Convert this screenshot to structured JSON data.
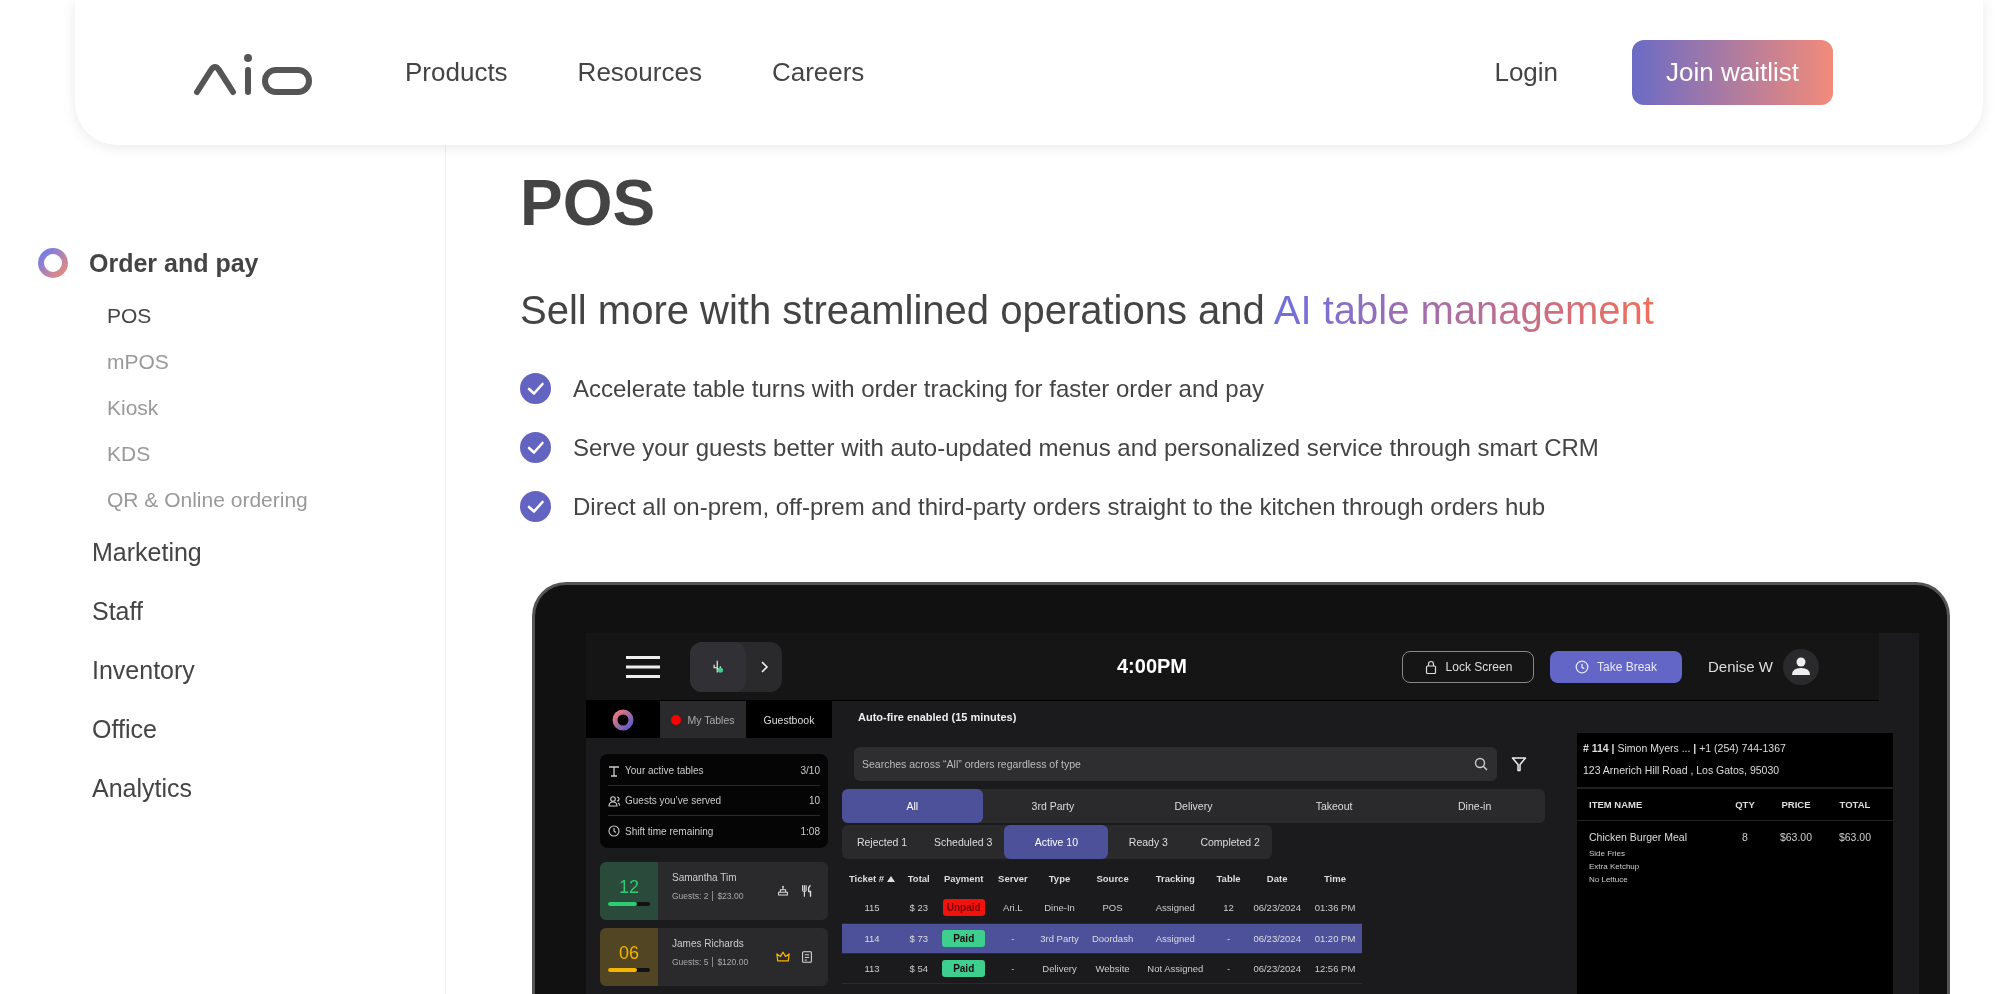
{
  "nav": {
    "links": [
      "Products",
      "Resources",
      "Careers"
    ],
    "login": "Login",
    "cta": "Join waitlist"
  },
  "sidebar": {
    "groups": [
      {
        "label": "Order and pay",
        "selected": true,
        "children": [
          {
            "label": "POS",
            "selected": true
          },
          {
            "label": "mPOS",
            "selected": false
          },
          {
            "label": "Kiosk",
            "selected": false
          },
          {
            "label": "KDS",
            "selected": false
          },
          {
            "label": "QR & Online ordering",
            "selected": false
          }
        ]
      },
      {
        "label": "Marketing",
        "selected": false
      },
      {
        "label": "Staff",
        "selected": false
      },
      {
        "label": "Inventory",
        "selected": false
      },
      {
        "label": "Office",
        "selected": false
      },
      {
        "label": "Analytics",
        "selected": false
      }
    ]
  },
  "page": {
    "title": "POS",
    "subtitle": "Sell more with streamlined operations and",
    "subtitle_highlight": "AI table management",
    "bullets": [
      "Accelerate table turns with order tracking for faster order and pay",
      "Serve your guests better with auto-updated menus and personalized service through smart CRM",
      "Direct all on-prem, off-prem and third-party orders straight to the kitchen through orders hub"
    ]
  },
  "pos": {
    "header": {
      "time": "4:00PM",
      "lock_button": "Lock Screen",
      "break_button": "Take Break",
      "user": "Denise W"
    },
    "panel_tabs": [
      {
        "label": "My Tables",
        "selected": true
      },
      {
        "label": "Guestbook",
        "selected": false
      }
    ],
    "stats": [
      {
        "kind": "tables",
        "label": "Your active tables",
        "value": "3/10"
      },
      {
        "kind": "guests",
        "label": "Guests you’ve served",
        "value": "10"
      },
      {
        "kind": "time",
        "label": "Shift time remaining",
        "value": "1:08"
      }
    ],
    "tables": [
      {
        "number": "12",
        "name": "Samantha Tim",
        "guests": "Guests: 2",
        "amount": "$23.00",
        "level": 0.7,
        "color": "#2ecc71"
      },
      {
        "number": "06",
        "name": "James Richards",
        "guests": "Guests: 5",
        "amount": "$120.00",
        "level": 0.7,
        "color": "#f5b400"
      }
    ],
    "auto_fire": "Auto-fire enabled (15 minutes)",
    "search": {
      "placeholder": "Searches across “All” orders regardless of type"
    },
    "type_tabs": [
      {
        "label": "All",
        "selected": true
      },
      {
        "label": "3rd Party",
        "selected": false
      },
      {
        "label": "Delivery",
        "selected": false
      },
      {
        "label": "Takeout",
        "selected": false
      },
      {
        "label": "Dine-in",
        "selected": false
      }
    ],
    "status_tabs": [
      {
        "label": "Rejected 1",
        "selected": false
      },
      {
        "label": "Scheduled 3",
        "selected": false
      },
      {
        "label": "Active 10",
        "selected": true
      },
      {
        "label": "Ready 3",
        "selected": false
      },
      {
        "label": "Completed 2",
        "selected": false
      }
    ],
    "orders": {
      "columns": [
        "Ticket #",
        "Total",
        "Payment",
        "Server",
        "Type",
        "Source",
        "Tracking",
        "Table",
        "Date",
        "Time"
      ],
      "rows": [
        {
          "selected": false,
          "paid": false,
          "cells": [
            "115",
            "$ 23",
            "Unpaid",
            "Ari.L",
            "Dine-In",
            "POS",
            "Assigned",
            "12",
            "06/23/2024",
            "01:36 PM"
          ]
        },
        {
          "selected": true,
          "paid": true,
          "cells": [
            "114",
            "$ 73",
            "Paid",
            "-",
            "3rd Party",
            "Doordash",
            "Assigned",
            "-",
            "06/23/2024",
            "01:20 PM"
          ]
        },
        {
          "selected": false,
          "paid": true,
          "cells": [
            "113",
            "$ 54",
            "Paid",
            "-",
            "Delivery",
            "Website",
            "Not Assigned",
            "-",
            "06/23/2024",
            "12:56 PM"
          ]
        }
      ]
    },
    "ticket": {
      "header": "**# 114 |** Simon Myers ... **|** +1 (254) 744-1367",
      "address": "123 Arnerich Hill Road , Los Gatos, 95030",
      "columns": [
        "ITEM NAME",
        "QTY",
        "PRICE",
        "TOTAL"
      ],
      "items": [
        {
          "name": "Chicken Burger Meal",
          "qty": "8",
          "price": "$63.00",
          "total": "$63.00",
          "modifiers": [
            "Side Fries",
            "Extra Ketchup",
            "No Lettuce"
          ]
        }
      ]
    }
  }
}
